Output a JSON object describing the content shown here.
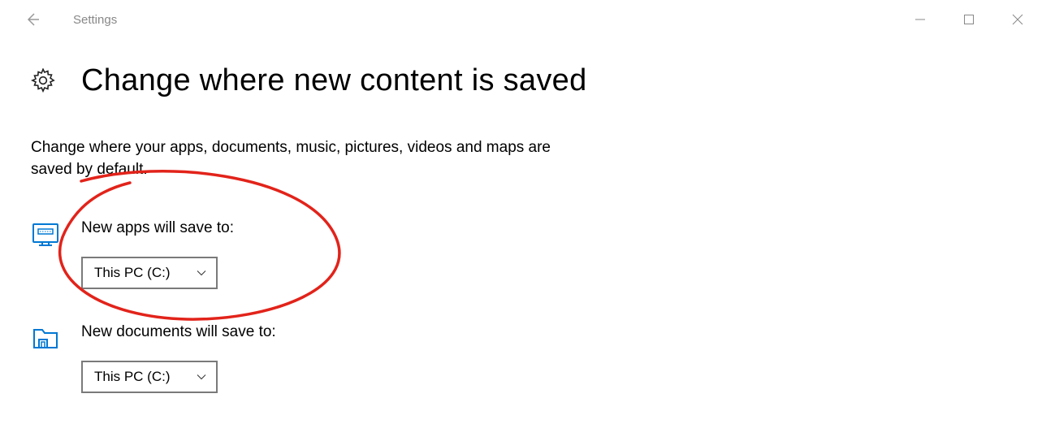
{
  "window": {
    "title": "Settings"
  },
  "page": {
    "title": "Change where new content is saved",
    "description": "Change where your apps, documents, music, pictures, videos and maps are saved by default."
  },
  "settings": {
    "apps": {
      "label": "New apps will save to:",
      "value": "This PC (C:)"
    },
    "documents": {
      "label": "New documents will save to:",
      "value": "This PC (C:)"
    }
  }
}
